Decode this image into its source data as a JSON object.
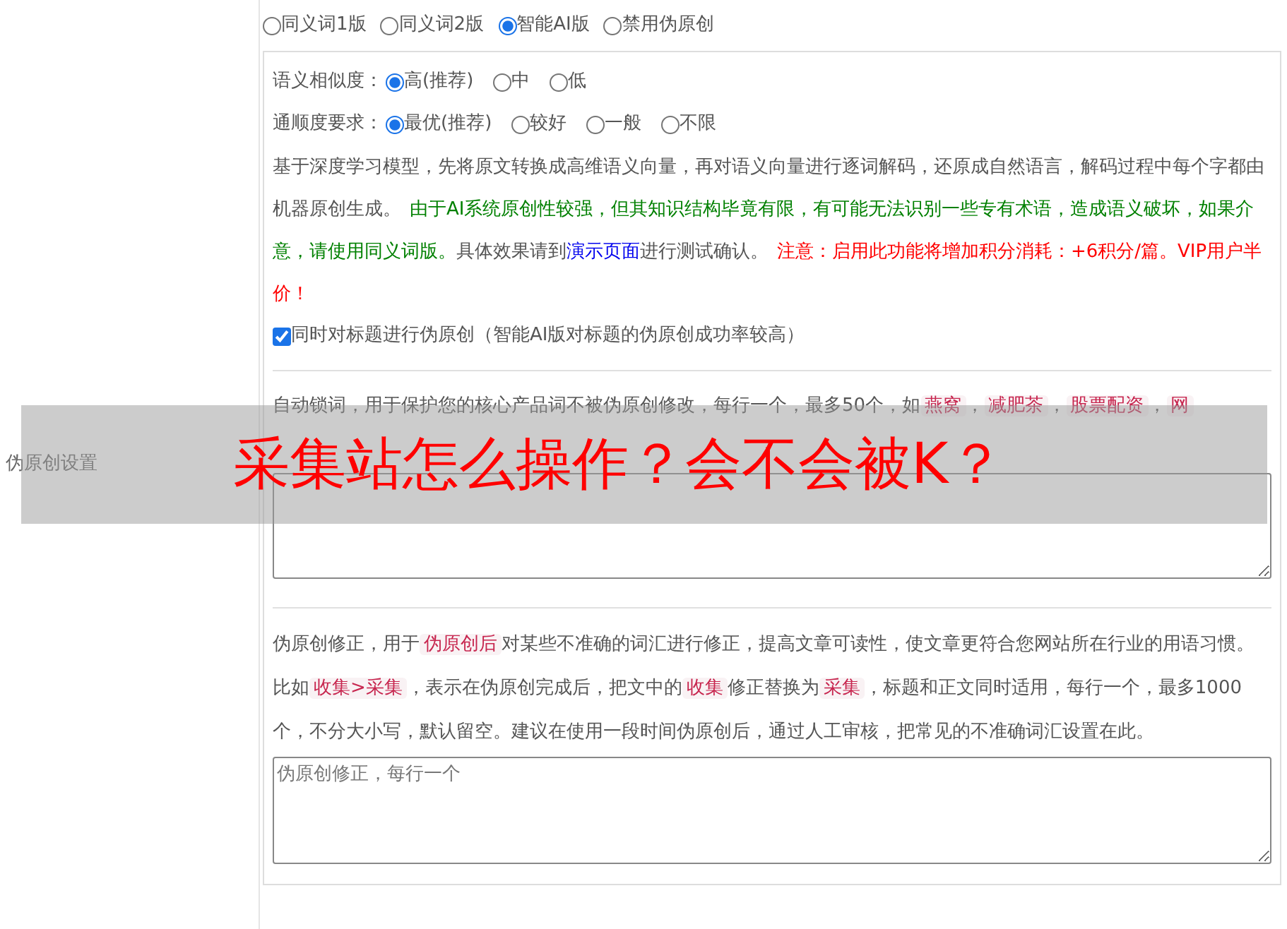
{
  "section_label": "伪原创设置",
  "modes": [
    {
      "label": "同义词1版",
      "selected": false
    },
    {
      "label": "同义词2版",
      "selected": false
    },
    {
      "label": "智能AI版",
      "selected": true
    },
    {
      "label": "禁用伪原创",
      "selected": false
    }
  ],
  "option_groups": [
    {
      "label": "语义相似度：",
      "options": [
        {
          "label": "高(推荐)",
          "selected": true
        },
        {
          "label": "中",
          "selected": false
        },
        {
          "label": "低",
          "selected": false
        }
      ]
    },
    {
      "label": "通顺度要求：",
      "options": [
        {
          "label": "最优(推荐)",
          "selected": true
        },
        {
          "label": "较好",
          "selected": false
        },
        {
          "label": "一般",
          "selected": false
        },
        {
          "label": "不限",
          "selected": false
        }
      ]
    }
  ],
  "description": [
    {
      "kind": "plain",
      "text": "基于深度学习模型，先将原文转换成高维语义向量，再对语义向量进行逐词解码，还原成自然语言，解码过程中每个字都由机器原创生成。"
    },
    {
      "kind": "caution",
      "text": "由于AI系统原创性较强，但其知识结构毕竟有限，有可能无法识别一些专有术语，造成语义破坏，如果介意，请使用同义词版。"
    },
    {
      "kind": "plain",
      "text": "具体效果请到"
    },
    {
      "kind": "link",
      "text": "演示页面"
    },
    {
      "kind": "plain",
      "text": "进行测试确认。"
    },
    {
      "kind": "warning",
      "text": "注意：启用此功能将增加积分消耗：+6积分/篇。VIP用户半价！"
    }
  ],
  "title_option": {
    "label": "同时对标题进行伪原创（智能AI版对标题的伪原创成功率较高）",
    "checked": true
  },
  "lock_words": {
    "text": [
      {
        "kind": "plain",
        "text": "自动锁词，用于保护您的核心产品词不被伪原创修改，每行一个，最多50个，如"
      },
      {
        "kind": "tag",
        "text": "燕窝"
      },
      {
        "kind": "plain",
        "text": "，"
      },
      {
        "kind": "tag",
        "text": "减肥茶"
      },
      {
        "kind": "plain",
        "text": "，"
      },
      {
        "kind": "tag",
        "text": "股票配资"
      },
      {
        "kind": "plain",
        "text": "，"
      },
      {
        "kind": "tag",
        "text": "网"
      }
    ]
  },
  "correction": {
    "text": [
      {
        "kind": "plain",
        "text": "伪原创修正，用于"
      },
      {
        "kind": "tag",
        "text": "伪原创后"
      },
      {
        "kind": "plain",
        "text": "对某些不准确的词汇进行修正，提高文章可读性，使文章更符合您网站所在行业的用语习惯。比如"
      },
      {
        "kind": "tag",
        "text": "收集>采集"
      },
      {
        "kind": "plain",
        "text": "，表示在伪原创完成后，把文中的"
      },
      {
        "kind": "tag",
        "text": "收集"
      },
      {
        "kind": "plain",
        "text": "修正替换为"
      },
      {
        "kind": "tag",
        "text": "采集"
      },
      {
        "kind": "plain",
        "text": "，标题和正文同时适用，每行一个，最多1000个，不分大小写，默认留空。建议在使用一段时间伪原创后，通过人工审核，把常见的不准确词汇设置在此。"
      }
    ],
    "placeholder": "伪原创修正，每行一个"
  },
  "banner": "采集站怎么操作？会不会被K？"
}
